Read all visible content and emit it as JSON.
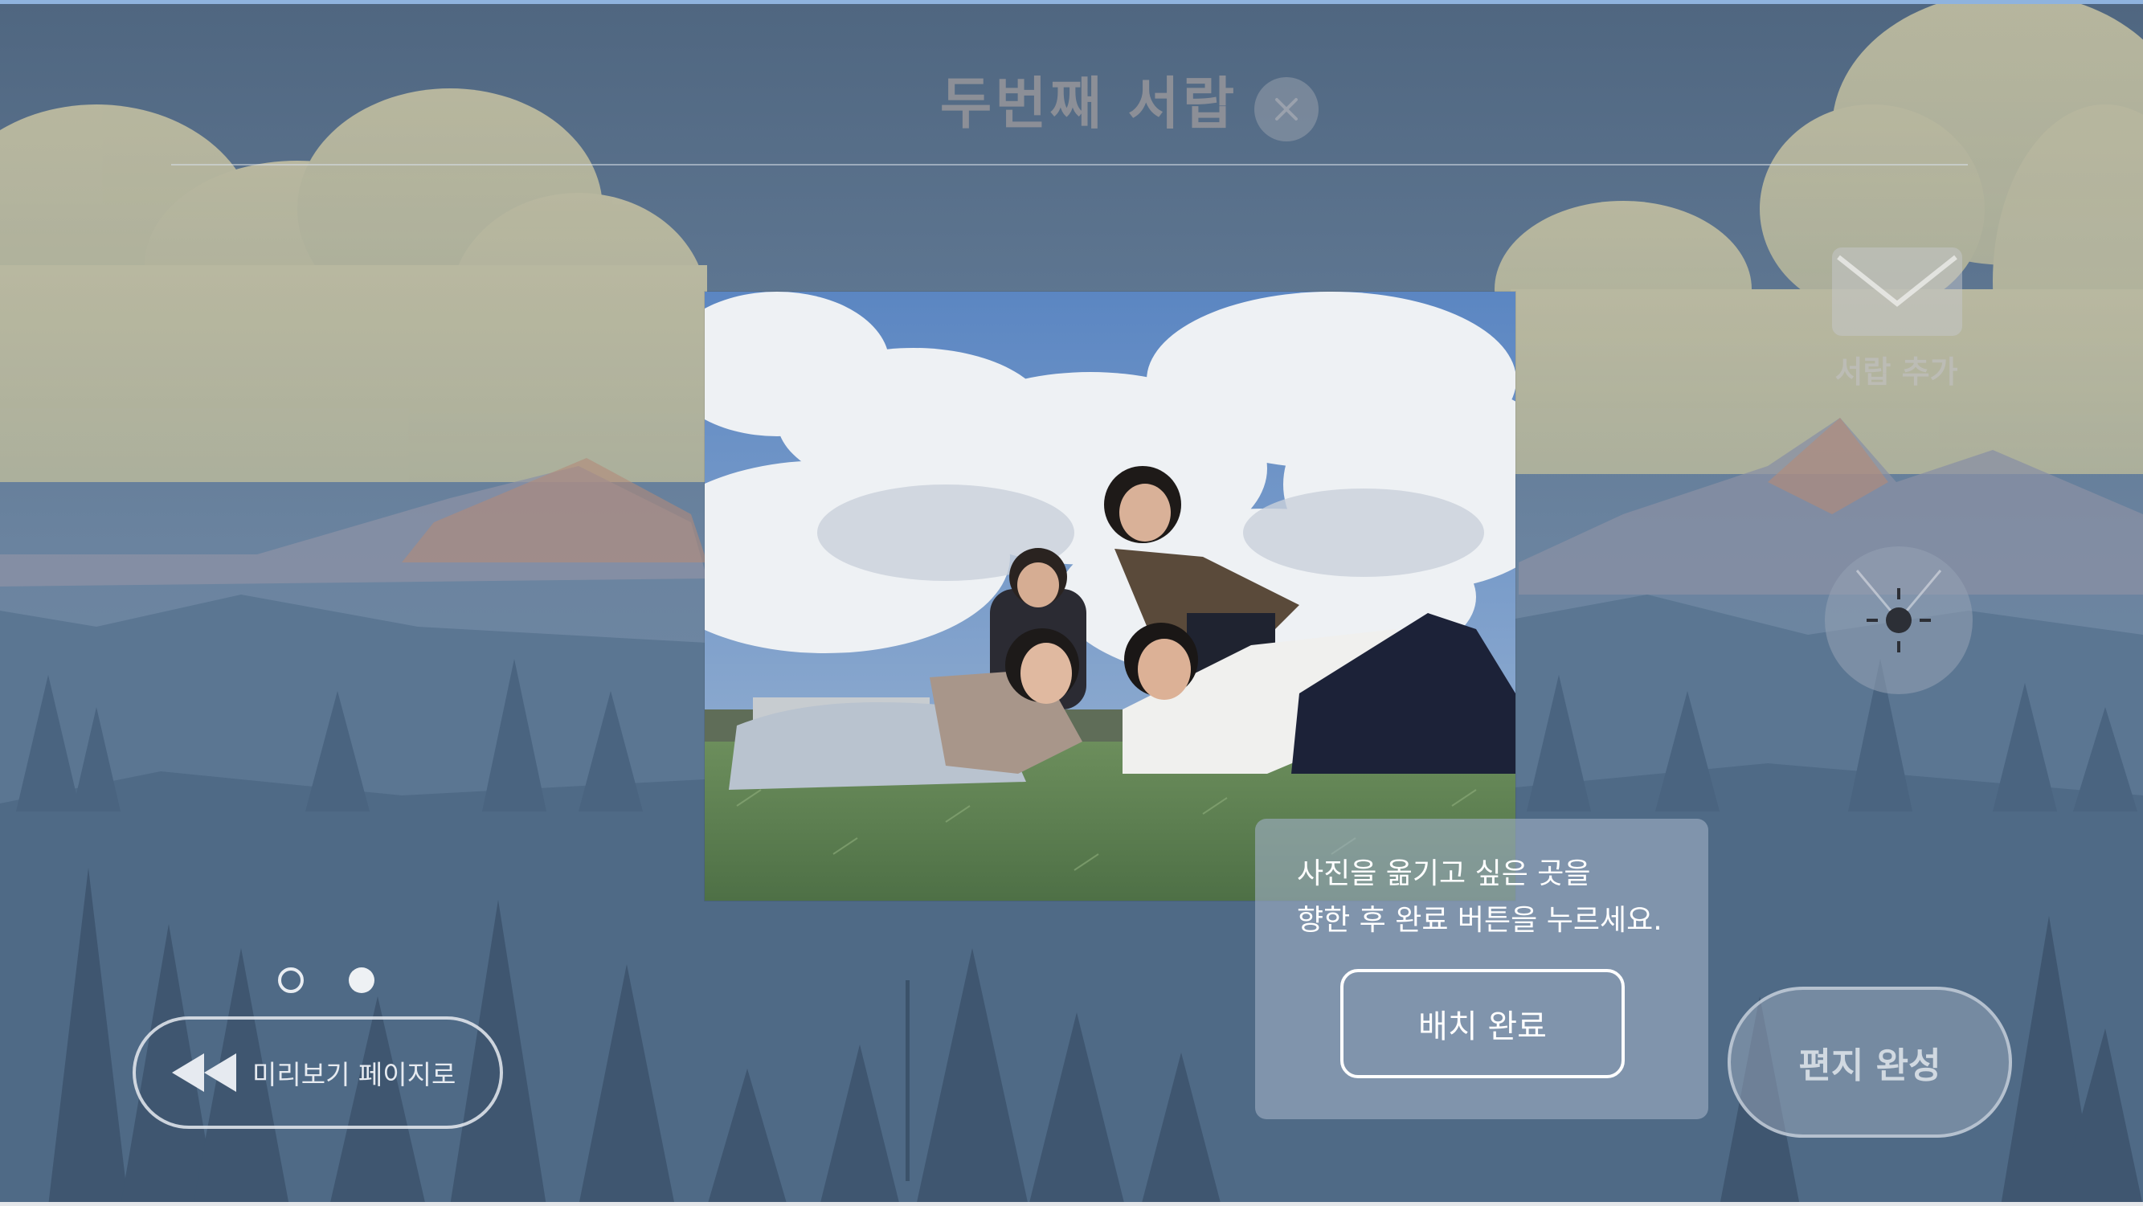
{
  "header": {
    "title": "두번째 서랍",
    "close_icon": "close-icon"
  },
  "sidebar_right": {
    "add_drawer_label": "서랍 추가",
    "add_drawer_icon": "envelope-icon",
    "time_icon": "sun-icon"
  },
  "photo": {
    "alt_icon": "photo"
  },
  "pagination": {
    "total": 2,
    "current": 2
  },
  "preview_button": {
    "label": "미리보기 페이지로",
    "icon": "rewind-icon"
  },
  "instruction": {
    "line1": "사진을 옮기고 싶은 곳을",
    "line2": "향한 후 완료 버튼을 누르세요.",
    "done_label": "배치 완료"
  },
  "finish_button": {
    "label": "편지 완성"
  },
  "colors": {
    "background_sky": "#6f89a3",
    "panel": "#9eafc4",
    "accent_top": "#8fb3de"
  }
}
